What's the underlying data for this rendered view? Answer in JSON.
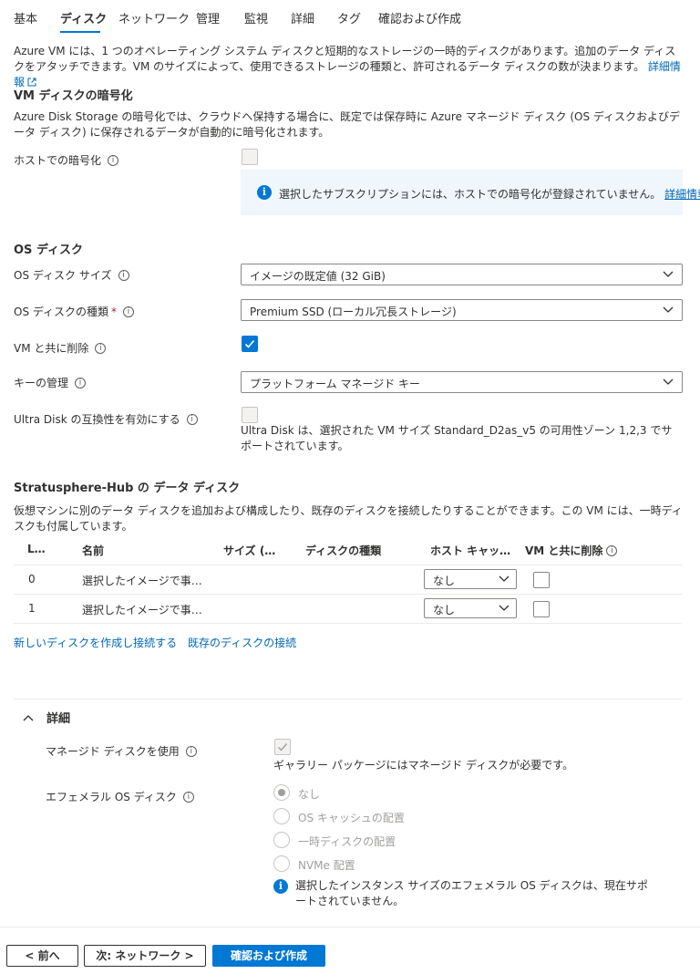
{
  "tabs": [
    {
      "label": "基本"
    },
    {
      "label": "ディスク"
    },
    {
      "label": "ネットワーク"
    },
    {
      "label": "管理"
    },
    {
      "label": "監視"
    },
    {
      "label": "詳細"
    },
    {
      "label": "タグ"
    },
    {
      "label": "確認および作成"
    }
  ],
  "intro": {
    "text": "Azure VM には、1 つのオペレーティング システム ディスクと短期的なストレージの一時的ディスクがあります。追加のデータ ディスクをアタッチできます。VM のサイズによって、使用できるストレージの種類と、許可されるデータ ディスクの数が決まります。",
    "link": "詳細情報"
  },
  "encryption": {
    "heading": "VM ディスクの暗号化",
    "desc": "Azure Disk Storage の暗号化では、クラウドへ保持する場合に、既定では保存時に Azure マネージド ディスク (OS ディスクおよびデータ ディスク) に保存されるデータが自動的に暗号化されます。",
    "host_label": "ホストでの暗号化",
    "notice": "選択したサブスクリプションには、ホストでの暗号化が登録されていません。",
    "notice_link": "詳細情報"
  },
  "os_disk": {
    "heading": "OS ディスク",
    "size_label": "OS ディスク サイズ",
    "size_value": "イメージの既定値 (32 GiB)",
    "type_label": "OS ディスクの種類",
    "required_mark": "*",
    "type_value": "Premium SSD (ローカル冗長ストレージ)",
    "delete_label": "VM と共に削除",
    "key_label": "キーの管理",
    "key_value": "プラットフォーム マネージド キー",
    "ultra_label": "Ultra Disk の互換性を有効にする",
    "ultra_note": "Ultra Disk は、選択された VM サイズ Standard_D2as_v5 の可用性ゾーン 1,2,3 でサポートされています。"
  },
  "data_disks": {
    "heading": "Stratusphere-Hub の データ ディスク",
    "desc": "仮想マシンに別のデータ ディスクを追加および構成したり、既存のディスクを接続したりすることができます。この VM には、一時ディスクも付属しています。",
    "columns": [
      "L…",
      "名前",
      "サイズ (…",
      "ディスクの種類",
      "ホスト キャッ…",
      "VM と共に削除"
    ],
    "rows": [
      {
        "lun": "0",
        "name": "選択したイメージで事…",
        "cache": "なし"
      },
      {
        "lun": "1",
        "name": "選択したイメージで事…",
        "cache": "なし"
      }
    ],
    "create_link": "新しいディスクを作成し接続する",
    "attach_link": "既存のディスクの接続"
  },
  "advanced": {
    "heading": "詳細",
    "managed_label": "マネージド ディスクを使用",
    "managed_note": "ギャラリー パッケージにはマネージド ディスクが必要です。",
    "ephemeral_label": "エフェメラル OS ディスク",
    "options": [
      "なし",
      "OS キャッシュの配置",
      "一時ディスクの配置",
      "NVMe 配置"
    ],
    "ephemeral_note": "選択したインスタンス サイズのエフェメラル OS ディスクは、現在サポートされていません。"
  },
  "footer": {
    "prev": "< 前へ",
    "next": "次: ネットワーク >",
    "review": "確認および作成"
  },
  "colors": {
    "accent": "#0078d4",
    "link": "#0067b8",
    "info_bg": "#eff6fc"
  }
}
